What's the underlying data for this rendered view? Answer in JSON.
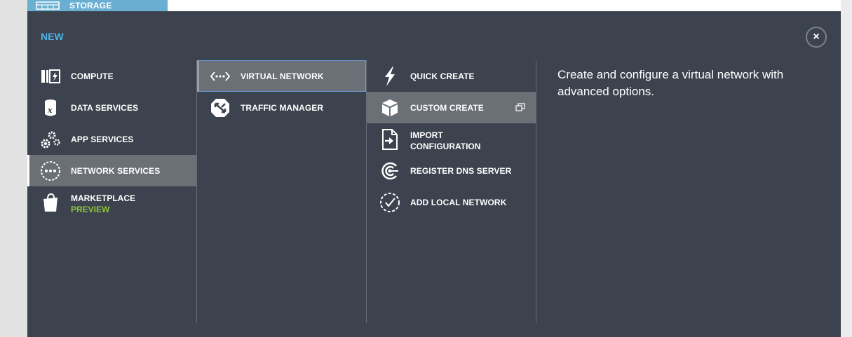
{
  "top_tab": {
    "label": "STORAGE",
    "icon": "storage-icon",
    "color": "#6aafd2"
  },
  "panel": {
    "title": "NEW",
    "close_label": "×",
    "background": "#3c434e",
    "accent": "#4fb3e3"
  },
  "categories": [
    {
      "label": "COMPUTE",
      "icon": "compute-icon"
    },
    {
      "label": "DATA SERVICES",
      "icon": "database-icon"
    },
    {
      "label": "APP SERVICES",
      "icon": "gears-icon"
    },
    {
      "label": "NETWORK SERVICES",
      "icon": "network-icon",
      "selected": true
    },
    {
      "label": "MARKETPLACE",
      "badge": "PREVIEW",
      "icon": "shopping-bag-icon"
    }
  ],
  "services": [
    {
      "label": "VIRTUAL NETWORK",
      "icon": "virtual-network-icon",
      "selected": true
    },
    {
      "label": "TRAFFIC MANAGER",
      "icon": "traffic-manager-icon"
    }
  ],
  "actions": [
    {
      "label": "QUICK CREATE",
      "icon": "lightning-icon"
    },
    {
      "label": "CUSTOM CREATE",
      "icon": "box-icon",
      "selected": true,
      "ext_icon": "open-wizard-icon"
    },
    {
      "label": "IMPORT",
      "label2": "CONFIGURATION",
      "icon": "import-file-icon"
    },
    {
      "label": "REGISTER DNS SERVER",
      "icon": "dns-icon"
    },
    {
      "label": "ADD LOCAL NETWORK",
      "icon": "check-circle-icon"
    }
  ],
  "description": "Create and configure a virtual network with advanced options.",
  "colors": {
    "preview_badge": "#8dc63f",
    "selected_row": "#6b7077",
    "selected_border": "#6f9bd6"
  }
}
